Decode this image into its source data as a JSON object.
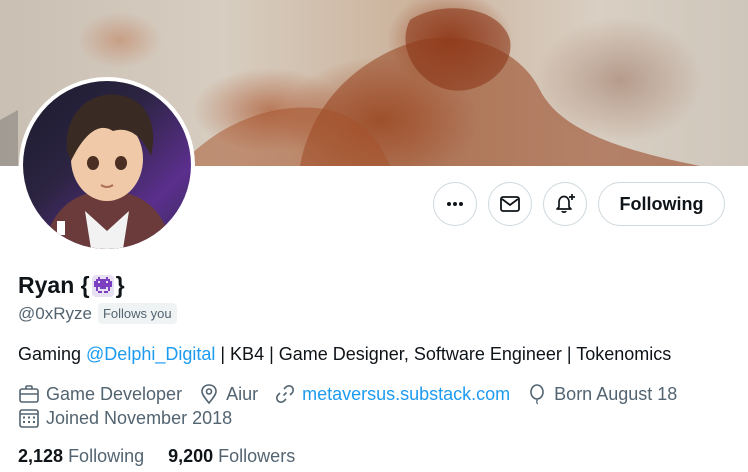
{
  "profile": {
    "name": "Ryan {",
    "name_suffix": "}",
    "handle": "@0xRyze",
    "follows_you": "Follows you",
    "bio": {
      "prefix": "Gaming ",
      "mention": "@Delphi_Digital",
      "suffix": " | KB4 | Game Designer, Software Engineer | Tokenomics"
    },
    "category": "Game Developer",
    "location": "Aiur",
    "website": "metaversus.substack.com",
    "birthday": "Born August 18",
    "joined": "Joined November 2018",
    "following_count": "2,128",
    "following_label": "Following",
    "followers_count": "9,200",
    "followers_label": "Followers"
  },
  "actions": {
    "more_icon": "more-icon",
    "message_icon": "envelope-icon",
    "notify_icon": "bell-plus-icon",
    "follow_label": "Following"
  },
  "colors": {
    "link": "#1d9bf0",
    "secondary_text": "#536471",
    "border": "#cfd9de",
    "emoji_purple": "#7b3fbf"
  }
}
